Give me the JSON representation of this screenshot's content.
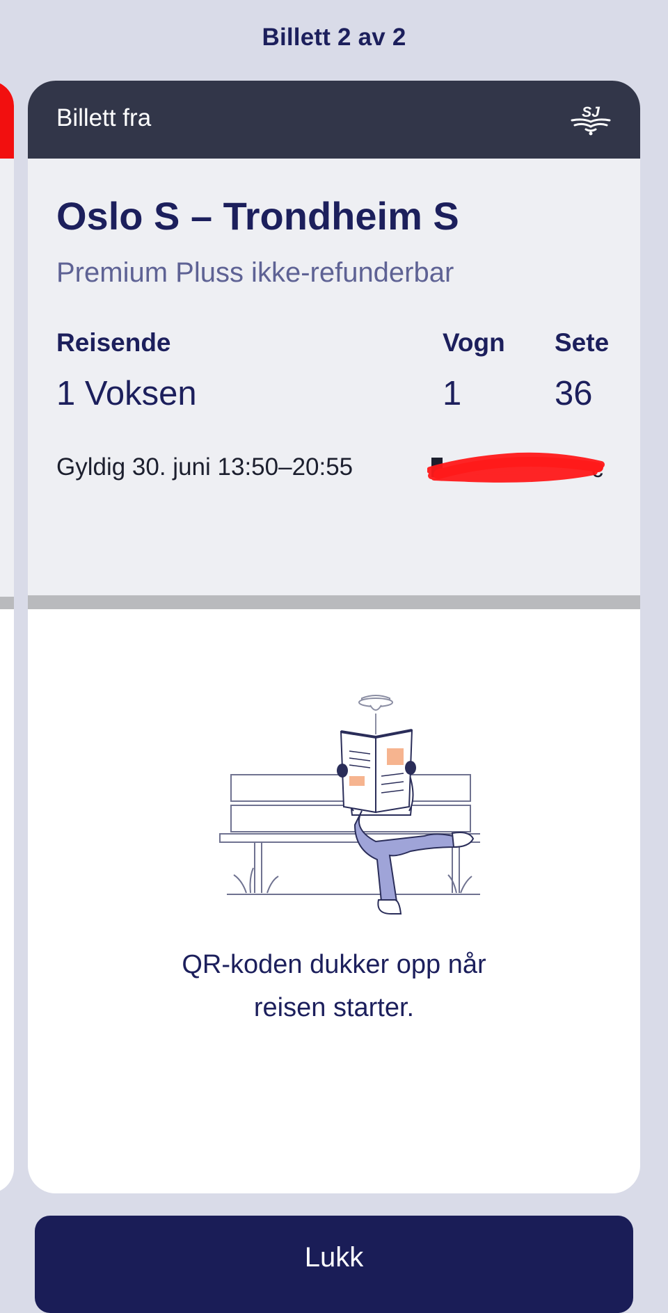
{
  "header": {
    "title": "Billett 2 av 2"
  },
  "ticket": {
    "header_label": "Billett fra",
    "logo_icon": "sj-logo-icon",
    "route": "Oslo S – Trondheim S",
    "fare": "Premium Pluss ikke-refunderbar",
    "travellers_label": "Reisende",
    "travellers_value": "1 Voksen",
    "car_label": "Vogn",
    "car_value": "1",
    "seat_label": "Sete",
    "seat_value": "36",
    "validity": "Gyldig 30. juni 13:50–20:55",
    "qr_message_line1": "QR-koden dukker opp når",
    "qr_message_line2": "reisen starter."
  },
  "footer": {
    "close_label": "Lukk"
  },
  "colors": {
    "page_background": "#d9dbe8",
    "header_dark": "#323649",
    "info_background": "#eeeff3",
    "text_primary": "#1c1f5c",
    "text_secondary": "#5e6294",
    "button_background": "#1a1d57",
    "prev_ticket_accent": "#f20f0f",
    "redaction_mark": "#ff1a1a"
  }
}
